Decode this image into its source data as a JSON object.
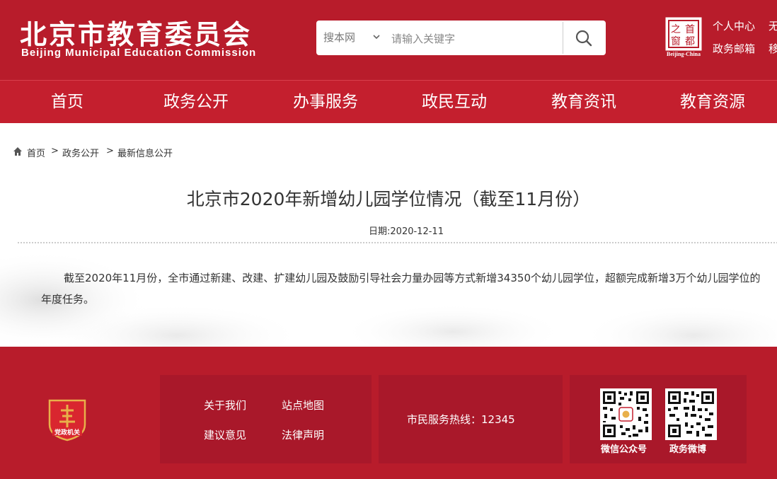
{
  "header": {
    "logo_cn": "北京市教育委员会",
    "logo_en": "Beijing Municipal Education Commission",
    "search": {
      "scope_label": "搜本网",
      "placeholder": "请输入关键字"
    },
    "seal": {
      "chars": [
        "首",
        "都",
        "之",
        "窗"
      ],
      "caption": "Beijing-China"
    },
    "links": [
      "个人中心",
      "无",
      "政务邮箱",
      "移"
    ]
  },
  "nav": {
    "items": [
      "首页",
      "政务公开",
      "办事服务",
      "政民互动",
      "教育资讯",
      "教育资源"
    ]
  },
  "breadcrumb": {
    "items": [
      "首页",
      "政务公开",
      "最新信息公开"
    ],
    "separator": ">"
  },
  "article": {
    "title": "北京市2020年新增幼儿园学位情况（截至11月份）",
    "date": "日期:2020-12-11",
    "body": "截至2020年11月份，全市通过新建、改建、扩建幼儿园及鼓励引导社会力量办园等方式新增34350个幼儿园学位，超额完成新增3万个幼儿园学位的年度任务。"
  },
  "footer": {
    "badge_text": "党政机关",
    "links": [
      "关于我们",
      "站点地图",
      "建议意见",
      "法律声明"
    ],
    "hotline": "市民服务热线：12345",
    "qr_codes": [
      "微信公众号",
      "政务微博"
    ]
  },
  "colors": {
    "brand_red": "#b81c2b",
    "nav_red": "#c41f2e",
    "footer_box": "#a9182a",
    "badge_gold": "#e8b04a"
  }
}
